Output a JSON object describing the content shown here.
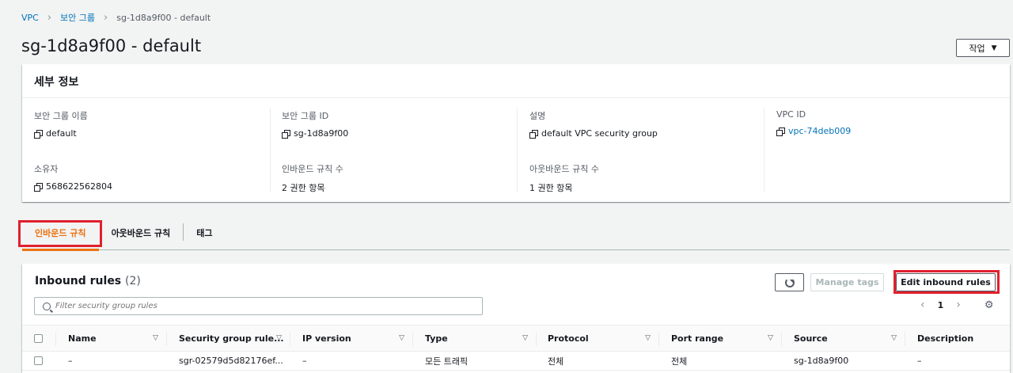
{
  "breadcrumb": {
    "items": [
      "VPC",
      "보안 그룹"
    ],
    "current": "sg-1d8a9f00 - default"
  },
  "page": {
    "title": "sg-1d8a9f00 - default",
    "actions_label": "작업"
  },
  "details": {
    "header": "세부 정보",
    "fields": [
      {
        "label": "보안 그룹 이름",
        "value": "default"
      },
      {
        "label": "보안 그룹 ID",
        "value": "sg-1d8a9f00"
      },
      {
        "label": "설명",
        "value": "default VPC security group"
      },
      {
        "label": "VPC ID",
        "value": "vpc-74deb009"
      },
      {
        "label": "소유자",
        "value": "568622562804"
      },
      {
        "label": "인바운드 규칙 수",
        "value": "2 권한 항목"
      },
      {
        "label": "아웃바운드 규칙 수",
        "value": "1 권한 항목"
      }
    ]
  },
  "tabs": [
    {
      "label": "인바운드 규칙",
      "active": true
    },
    {
      "label": "아웃바운드 규칙",
      "active": false
    },
    {
      "label": "태그",
      "active": false
    }
  ],
  "rules": {
    "title": "Inbound rules",
    "count": "(2)",
    "manage_tags_label": "Manage tags",
    "edit_label": "Edit inbound rules",
    "filter_placeholder": "Filter security group rules",
    "page_number": "1",
    "columns": [
      "Name",
      "Security group rule...",
      "IP version",
      "Type",
      "Protocol",
      "Port range",
      "Source",
      "Description"
    ],
    "rows": [
      [
        "–",
        "sgr-02579d5d82176ef...",
        "–",
        "모든 트래픽",
        "전체",
        "전체",
        "sg-1d8a9f00",
        "–"
      ]
    ]
  },
  "colors": {
    "accent": "#ec7211",
    "link": "#0073bb",
    "highlight": "#e0202e"
  }
}
